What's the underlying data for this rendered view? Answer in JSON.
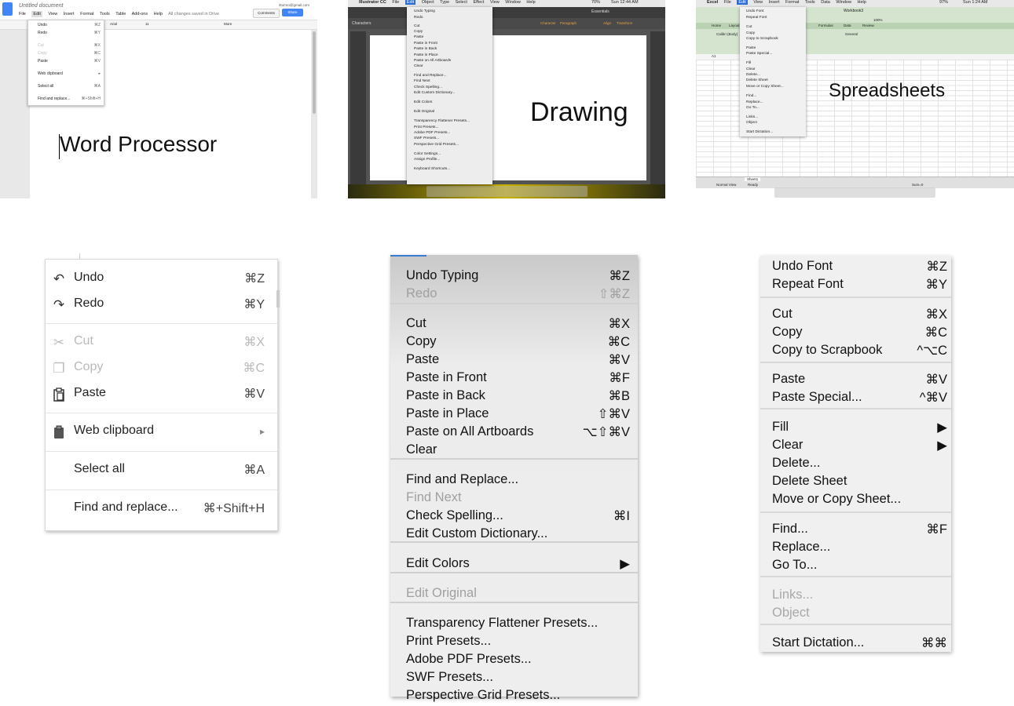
{
  "thumbnails": {
    "google_docs": {
      "doc_title": "Untitled document",
      "menus": [
        "File",
        "Edit",
        "View",
        "Insert",
        "Format",
        "Tools",
        "Table",
        "Add-ons",
        "Help"
      ],
      "saved_status": "All changes saved in Drive",
      "account_email": "ittumro@gmail.com",
      "comments_label": "Comments",
      "share_label": "Share",
      "toolbar_font": "Arial",
      "toolbar_size": "11",
      "toolbar_more": "More",
      "body_text": "Word Processor",
      "mini_menu": [
        {
          "label": "Undo",
          "shortcut": "⌘Z",
          "disabled": false
        },
        {
          "label": "Redo",
          "shortcut": "⌘Y",
          "disabled": false
        },
        {
          "label": "Cut",
          "shortcut": "⌘X",
          "disabled": true
        },
        {
          "label": "Copy",
          "shortcut": "⌘C",
          "disabled": true
        },
        {
          "label": "Paste",
          "shortcut": "⌘V",
          "disabled": false
        },
        {
          "label": "Web clipboard",
          "shortcut": "▸",
          "disabled": false
        },
        {
          "label": "Select all",
          "shortcut": "⌘A",
          "disabled": false
        },
        {
          "label": "Find and replace...",
          "shortcut": "⌘+Shift+H",
          "disabled": false
        }
      ]
    },
    "illustrator": {
      "menus": [
        "Illustrator CC",
        "File",
        "Edit",
        "Object",
        "Type",
        "Select",
        "Effect",
        "View",
        "Window",
        "Help"
      ],
      "clock": "Sun 12:44 AM",
      "battery": "70%",
      "workspace": "Essentials",
      "panel_label": "Characters",
      "ctrl_labels": [
        "Character",
        "Paragraph",
        "Align",
        "Transform"
      ],
      "zoom": "100%",
      "canvas_text": "Drawing",
      "mini_menu": [
        "Undo Typing",
        "Redo",
        "Cut",
        "Copy",
        "Paste",
        "Paste in Front",
        "Paste in Back",
        "Paste in Place",
        "Paste on All Artboards",
        "Clear",
        "Find and Replace...",
        "Find Next",
        "Check Spelling...",
        "Edit Custom Dictionary...",
        "Edit Colors",
        "Edit Original",
        "Transparency Flattener Presets...",
        "Print Presets...",
        "Adobe PDF Presets...",
        "SWF Presets...",
        "Perspective Grid Presets...",
        "Color Settings...",
        "Assign Profile...",
        "Keyboard Shortcuts..."
      ],
      "mini_menu_extra_shortcuts": {
        "Color Settings...": "⇧⌘K",
        "Keyboard Shortcuts...": "⌥⇧⌘K"
      }
    },
    "excel": {
      "menus": [
        "Excel",
        "File",
        "Edit",
        "View",
        "Insert",
        "Format",
        "Tools",
        "Data",
        "Window",
        "Help"
      ],
      "clock": "Sun 1:24 AM",
      "battery": "97%",
      "workbook": "Workbook3",
      "ribbon_tabs": [
        "Home",
        "Layout",
        "Formulas",
        "Data",
        "Review"
      ],
      "font_name": "Calibri (Body)",
      "number_format": "General",
      "cell_ref": "A1",
      "zoom": "100%",
      "sheet_tab": "Sheet1",
      "status_view": "Normal View",
      "status_ready": "Ready",
      "status_sum": "Sum=0",
      "canvas_text": "Spreadsheets",
      "mini_menu": [
        "Undo Font",
        "Repeat Font",
        "Cut",
        "Copy",
        "Copy to Scrapbook",
        "Paste",
        "Paste Special...",
        "Fill",
        "Clear",
        "Delete...",
        "Delete Sheet",
        "Move or Copy Sheet...",
        "Find...",
        "Replace...",
        "Go To...",
        "Links...",
        "Object",
        "Start Dictation..."
      ]
    }
  },
  "menus": {
    "google": {
      "items": [
        {
          "icon": "undo-icon",
          "glyph": "↶",
          "label": "Undo",
          "shortcut": "⌘Z",
          "disabled": false
        },
        {
          "icon": "redo-icon",
          "glyph": "↷",
          "label": "Redo",
          "shortcut": "⌘Y",
          "disabled": false
        },
        {
          "icon": "scissors-icon",
          "glyph": "✂",
          "label": "Cut",
          "shortcut": "⌘X",
          "disabled": true
        },
        {
          "icon": "copy-icon",
          "glyph": "❐",
          "label": "Copy",
          "shortcut": "⌘C",
          "disabled": true
        },
        {
          "icon": "paste-icon",
          "glyph": "📋",
          "label": "Paste",
          "shortcut": "⌘V",
          "disabled": false
        },
        {
          "icon": "clipboard-icon",
          "glyph": "📋",
          "label": "Web clipboard",
          "shortcut": "▸",
          "disabled": false
        },
        {
          "icon": "",
          "glyph": "",
          "label": "Select all",
          "shortcut": "⌘A",
          "disabled": false
        },
        {
          "icon": "",
          "glyph": "",
          "label": "Find and replace...",
          "shortcut": "⌘+Shift+H",
          "disabled": false
        }
      ]
    },
    "illustrator": {
      "items": [
        {
          "label": "Undo Typing",
          "shortcut": "⌘Z",
          "disabled": false
        },
        {
          "label": "Redo",
          "shortcut": "⇧⌘Z",
          "disabled": true
        },
        {
          "label": "Cut",
          "shortcut": "⌘X",
          "disabled": false
        },
        {
          "label": "Copy",
          "shortcut": "⌘C",
          "disabled": false
        },
        {
          "label": "Paste",
          "shortcut": "⌘V",
          "disabled": false
        },
        {
          "label": "Paste in Front",
          "shortcut": "⌘F",
          "disabled": false
        },
        {
          "label": "Paste in Back",
          "shortcut": "⌘B",
          "disabled": false
        },
        {
          "label": "Paste in Place",
          "shortcut": "⇧⌘V",
          "disabled": false
        },
        {
          "label": "Paste on All Artboards",
          "shortcut": "⌥⇧⌘V",
          "disabled": false
        },
        {
          "label": "Clear",
          "shortcut": "",
          "disabled": false
        },
        {
          "label": "Find and Replace...",
          "shortcut": "",
          "disabled": false
        },
        {
          "label": "Find Next",
          "shortcut": "",
          "disabled": true
        },
        {
          "label": "Check Spelling...",
          "shortcut": "⌘I",
          "disabled": false
        },
        {
          "label": "Edit Custom Dictionary...",
          "shortcut": "",
          "disabled": false
        },
        {
          "label": "Edit Colors",
          "shortcut": "▶",
          "disabled": false
        },
        {
          "label": "Edit Original",
          "shortcut": "",
          "disabled": true
        },
        {
          "label": "Transparency Flattener Presets...",
          "shortcut": "",
          "disabled": false
        },
        {
          "label": "Print Presets...",
          "shortcut": "",
          "disabled": false
        },
        {
          "label": "Adobe PDF Presets...",
          "shortcut": "",
          "disabled": false
        },
        {
          "label": "SWF Presets...",
          "shortcut": "",
          "disabled": false
        },
        {
          "label": "Perspective Grid Presets...",
          "shortcut": "",
          "disabled": false
        }
      ]
    },
    "excel": {
      "items": [
        {
          "label": "Undo Font",
          "shortcut": "⌘Z",
          "disabled": false
        },
        {
          "label": "Repeat Font",
          "shortcut": "⌘Y",
          "disabled": false
        },
        {
          "label": "Cut",
          "shortcut": "⌘X",
          "disabled": false
        },
        {
          "label": "Copy",
          "shortcut": "⌘C",
          "disabled": false
        },
        {
          "label": "Copy to Scrapbook",
          "shortcut": "^⌥C",
          "disabled": false
        },
        {
          "label": "Paste",
          "shortcut": "⌘V",
          "disabled": false
        },
        {
          "label": "Paste Special...",
          "shortcut": "^⌘V",
          "disabled": false
        },
        {
          "label": "Fill",
          "shortcut": "▶",
          "disabled": false
        },
        {
          "label": "Clear",
          "shortcut": "▶",
          "disabled": false
        },
        {
          "label": "Delete...",
          "shortcut": "",
          "disabled": false
        },
        {
          "label": "Delete Sheet",
          "shortcut": "",
          "disabled": false
        },
        {
          "label": "Move or Copy Sheet...",
          "shortcut": "",
          "disabled": false
        },
        {
          "label": "Find...",
          "shortcut": "⌘F",
          "disabled": false
        },
        {
          "label": "Replace...",
          "shortcut": "",
          "disabled": false
        },
        {
          "label": "Go To...",
          "shortcut": "",
          "disabled": false
        },
        {
          "label": "Links...",
          "shortcut": "",
          "disabled": true
        },
        {
          "label": "Object",
          "shortcut": "",
          "disabled": true
        },
        {
          "label": "Start Dictation...",
          "shortcut": "⌘⌘",
          "disabled": false
        }
      ]
    }
  }
}
